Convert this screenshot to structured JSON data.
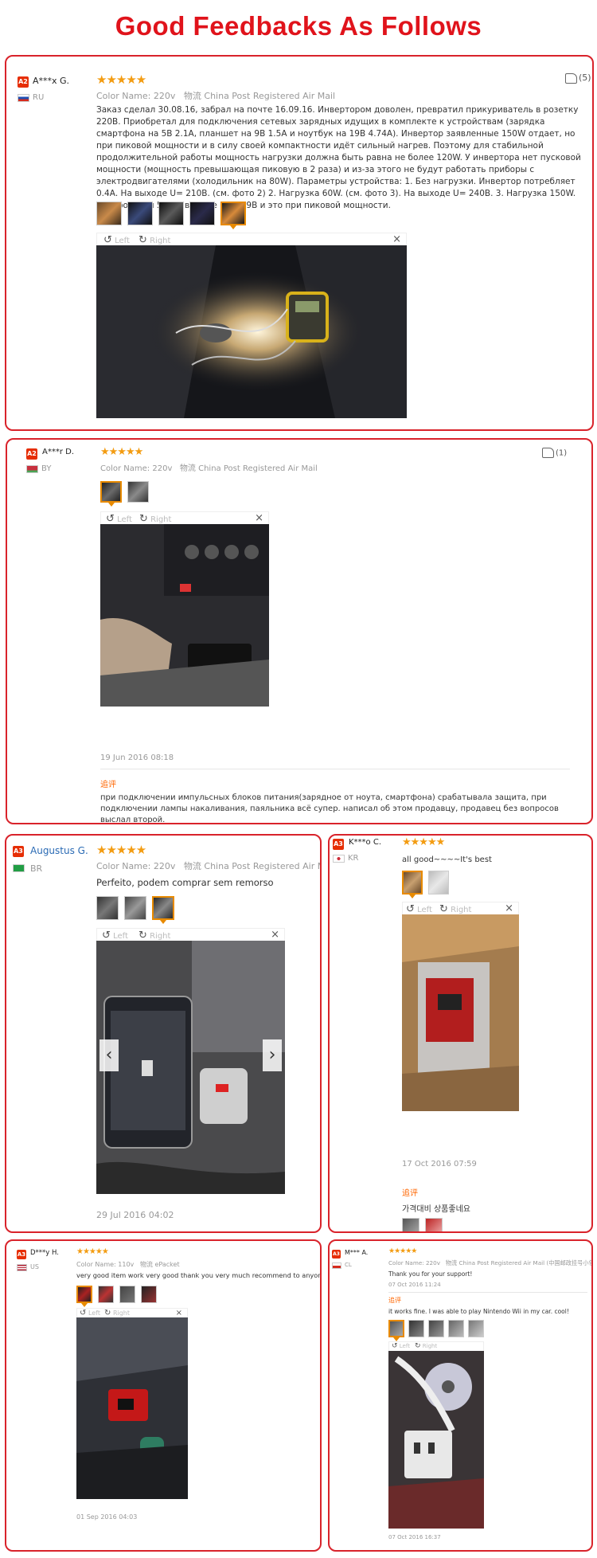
{
  "page_title": "Good Feedbacks As Follows",
  "reviews": [
    {
      "level": "A2",
      "user": "A***x G.",
      "country": "RU",
      "color_label": "Color Name:",
      "color_value": "220v",
      "shipping_label": "物流",
      "shipping": "China Post Registered Air Mail",
      "likes": "(5)",
      "text": "Заказ сделал 30.08.16, забрал на почте 16.09.16. Инвертором доволен, превратил прикуриватель в розетку 220В. Приобретал для подключения сетевых зарядных идущих в комплекте к устройствам (зарядка смартфона на 5В 2.1А, планшет на 9В 1.5А и ноутбук на 19В 4.74А). Инвертор заявленные 150W отдает, но при пиковой мощности и в силу своей компактности идёт сильный нагрев. Поэтому для стабильной продолжительной работы мощность нагрузки должна быть равна не более 120W. У инвертора нет пусковой мощности (мощность превышающая пиковую в 2 раза) и из-за этого не будут работать приборы с электродвигателями (холодильник на 80W). Параметры устройства: 1. Без нагрузки. Инвертор потребляет 0.4А. На выходе U= 210В. (см. фото 2) 2. Нагрузка 60W. (см. фото 3). На выходе U= 240В. 3. Нагрузка 150W.(см. фото 4 и 5). На выходе U= 219В и это при пиковой мощности.",
      "rotate_left": "Left",
      "rotate_right": "Right"
    },
    {
      "level": "A2",
      "user": "A***r D.",
      "country": "BY",
      "color_label": "Color Name:",
      "color_value": "220v",
      "shipping_label": "物流",
      "shipping": "China Post Registered Air Mail",
      "likes": "(1)",
      "date": "19 Jun 2016 08:18",
      "followup_label": "追评",
      "followup": "при подключении импульсных блоков питания(зарядное от ноута, смартфона) срабатывала защита, при подключении лампы накаливания, паяльника всё супер. написал об этом продавцу, продавец без вопросов выслал второй.",
      "rotate_left": "Left",
      "rotate_right": "Right"
    },
    {
      "level": "A3",
      "user": "Augustus G.",
      "country": "BR",
      "color_label": "Color Name:",
      "color_value": "220v",
      "shipping_label": "物流",
      "shipping": "China Post Registered Air Mail",
      "text": "Perfeito, podem comprar sem remorso",
      "date": "29 Jul 2016 04:02",
      "rotate_left": "Left",
      "rotate_right": "Right"
    },
    {
      "level": "A3",
      "user": "K***o C.",
      "country": "KR",
      "text": "all good~~~~It's best",
      "date": "17 Oct 2016 07:59",
      "followup_label": "追评",
      "followup": "가격대비 상품좋네요",
      "rotate_left": "Left",
      "rotate_right": "Right"
    },
    {
      "level": "A3",
      "user": "D***y H.",
      "country": "US",
      "color_label": "Color Name:",
      "color_value": "110v",
      "shipping_label": "物流",
      "shipping": "ePacket",
      "text": "very good item work very good thank you very much recommend to anyone",
      "date": "01 Sep 2016 04:03",
      "rotate_left": "Left",
      "rotate_right": "Right"
    },
    {
      "level": "A3",
      "user": "M*** A.",
      "country": "CL",
      "color_label": "Color Name:",
      "color_value": "220v",
      "shipping_label": "物流",
      "shipping": "China Post Registered Air Mail (中国邮政挂号小包)",
      "text": "Thank you for your support!",
      "date": "07 Oct 2016 11:24",
      "followup_label": "追评",
      "followup": "it works fine. I was able to play Nintendo Wii in my car. cool!",
      "date2": "07 Oct 2016 16:37",
      "rotate_left": "Left",
      "rotate_right": "Right"
    }
  ],
  "stars": "★★★★★",
  "colors": {
    "accent": "#e0131b",
    "star": "#f39c12",
    "followup": "#ff6600"
  }
}
